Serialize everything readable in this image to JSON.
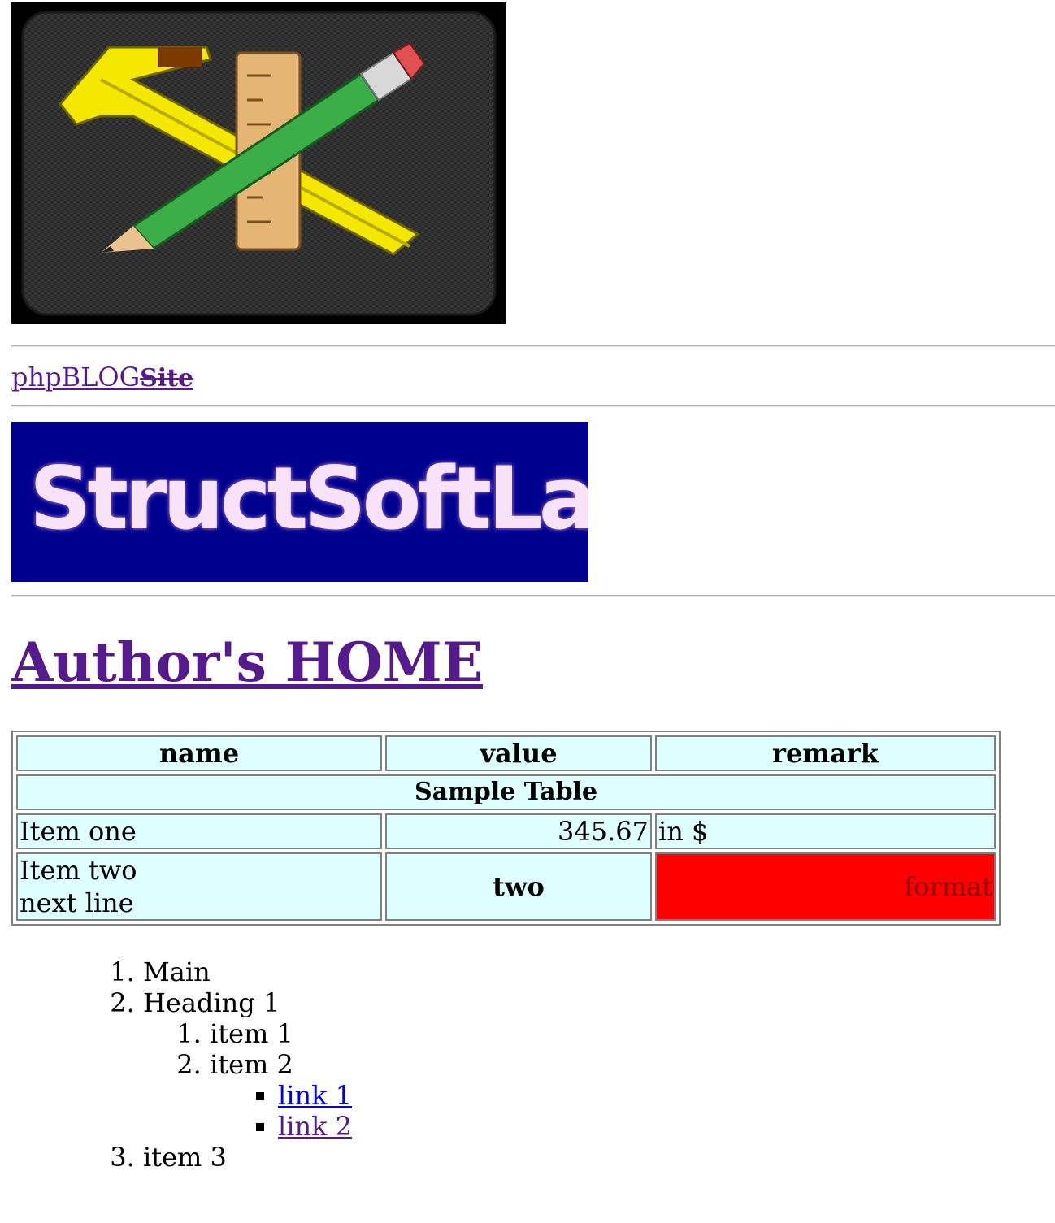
{
  "site": {
    "name": "phpBLOG",
    "struck": "Site"
  },
  "banner": {
    "text": "StructSoftLab"
  },
  "page": {
    "title": "Author's HOME"
  },
  "table": {
    "headers": [
      "name",
      "value",
      "remark"
    ],
    "caption": "Sample Table",
    "row1": {
      "name": "Item one",
      "value": "345.67",
      "remark": "in $"
    },
    "row2": {
      "name_line1": "Item two",
      "name_line2": "next line",
      "value": "two",
      "remark": "format"
    }
  },
  "outline": {
    "items": [
      "Main",
      "Heading 1",
      "item 3"
    ],
    "sub_items": [
      "item 1",
      "item 2"
    ],
    "links": [
      "link 1",
      "link 2"
    ]
  },
  "colors": {
    "link_visited": "#551a8b",
    "link_unvisited": "#0000ee",
    "table_bg": "#ddffff",
    "highlight": "#ff0000",
    "banner_bg": "#00008f"
  }
}
